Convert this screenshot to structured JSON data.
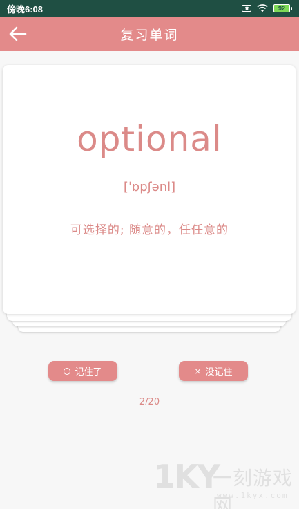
{
  "status_bar": {
    "time": "傍晚6:08",
    "battery": "92"
  },
  "app_bar": {
    "title": "复习单词"
  },
  "card": {
    "word": "optional",
    "phonetic": "[ˈɒpʃənl]",
    "meaning": "可选择的; 随意的，任任意的"
  },
  "buttons": {
    "remembered": "记住了",
    "forgot": "没记住"
  },
  "progress": "2/20",
  "watermark": {
    "logo": "1KY",
    "text": "一刻游戏网",
    "url": "www.1kyx.com"
  },
  "colors": {
    "accent": "#e38a8a",
    "text_accent": "#db8a88",
    "status_bar": "#1f4f43"
  }
}
